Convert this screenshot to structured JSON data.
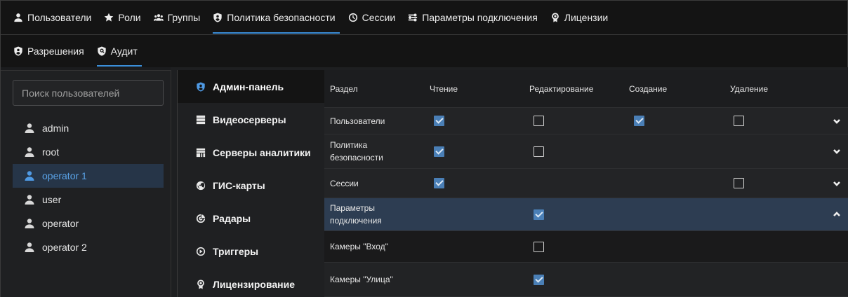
{
  "topnav": {
    "tabs": [
      {
        "label": "Пользователи",
        "icon": "user-icon"
      },
      {
        "label": "Роли",
        "icon": "star-icon"
      },
      {
        "label": "Группы",
        "icon": "group-icon"
      },
      {
        "label": "Политика безопасности",
        "icon": "shield-icon",
        "active": true
      },
      {
        "label": "Сессии",
        "icon": "clock-icon"
      },
      {
        "label": "Параметры подключения",
        "icon": "connection-icon"
      },
      {
        "label": "Лицензии",
        "icon": "license-icon"
      }
    ]
  },
  "subnav": {
    "tabs": [
      {
        "label": "Разрешения",
        "icon": "shield-icon"
      },
      {
        "label": "Аудит",
        "icon": "audit-icon",
        "active": true
      }
    ]
  },
  "sidebar": {
    "search_placeholder": "Поиск пользователей",
    "users": [
      {
        "name": "admin"
      },
      {
        "name": "root"
      },
      {
        "name": "operator 1",
        "selected": true
      },
      {
        "name": "user"
      },
      {
        "name": "operator"
      },
      {
        "name": "operator 2"
      }
    ]
  },
  "categories": [
    {
      "label": "Админ-панель",
      "icon": "shield-icon",
      "active": true
    },
    {
      "label": "Видеосерверы",
      "icon": "server-icon"
    },
    {
      "label": "Серверы аналитики",
      "icon": "analytics-server-icon"
    },
    {
      "label": "ГИС-карты",
      "icon": "globe-icon"
    },
    {
      "label": "Радары",
      "icon": "radar-icon"
    },
    {
      "label": "Триггеры",
      "icon": "trigger-icon"
    },
    {
      "label": "Лицензирование",
      "icon": "license-icon"
    }
  ],
  "table": {
    "headers": {
      "section": "Раздел",
      "read": "Чтение",
      "edit": "Редактирование",
      "create": "Создание",
      "delete": "Удаление"
    },
    "rows": [
      {
        "section": "Пользователи",
        "read": true,
        "edit": false,
        "create": true,
        "delete": false,
        "expand": "down"
      },
      {
        "section": "Политика безопасности",
        "read": true,
        "edit": false,
        "create": null,
        "delete": null,
        "expand": "down"
      },
      {
        "section": "Сессии",
        "read": true,
        "edit": null,
        "create": null,
        "delete": false,
        "expand": "down"
      },
      {
        "section": "Параметры подключения",
        "read": null,
        "edit": true,
        "create": null,
        "delete": null,
        "expand": "up",
        "selected": true
      },
      {
        "section": "Камеры \"Вход\"",
        "read": null,
        "edit": false,
        "create": null,
        "delete": null,
        "child": true
      },
      {
        "section": "Камеры \"Улица\"",
        "read": null,
        "edit": true,
        "create": null,
        "delete": null,
        "child": true
      }
    ]
  },
  "colors": {
    "accent": "#3b8ed8",
    "checkbox_checked": "#4a7fb6",
    "selected_row": "#2d3d52",
    "selected_user": "#263548"
  }
}
